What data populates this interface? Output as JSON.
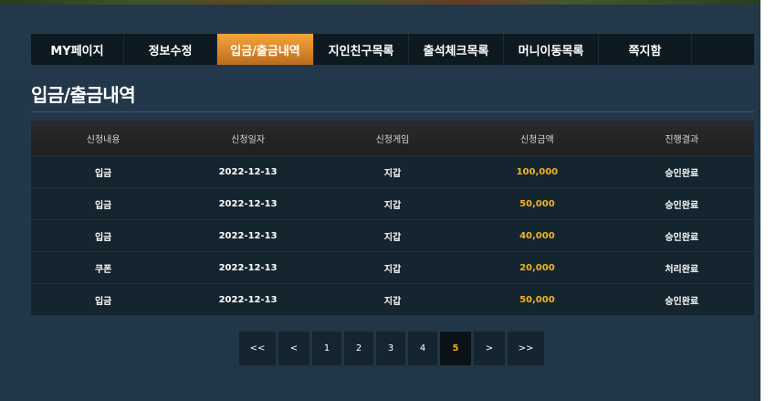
{
  "tabs": [
    {
      "label": "MY페이지"
    },
    {
      "label": "정보수정"
    },
    {
      "label": "입금/출금내역"
    },
    {
      "label": "지인친구목록"
    },
    {
      "label": "출석체크목록"
    },
    {
      "label": "머니이동목록"
    },
    {
      "label": "쪽지함"
    }
  ],
  "active_tab_index": 2,
  "page_title": "입금/출금내역",
  "table": {
    "headers": [
      "신청내용",
      "신청일자",
      "신청게임",
      "신청금액",
      "진행결과"
    ],
    "rows": [
      {
        "type": "입금",
        "date": "2022-12-13",
        "game": "지갑",
        "amount": "100,000",
        "result": "승인완료"
      },
      {
        "type": "입금",
        "date": "2022-12-13",
        "game": "지갑",
        "amount": "50,000",
        "result": "승인완료"
      },
      {
        "type": "입금",
        "date": "2022-12-13",
        "game": "지갑",
        "amount": "40,000",
        "result": "승인완료"
      },
      {
        "type": "쿠폰",
        "date": "2022-12-13",
        "game": "지갑",
        "amount": "20,000",
        "result": "처리완료"
      },
      {
        "type": "입금",
        "date": "2022-12-13",
        "game": "지갑",
        "amount": "50,000",
        "result": "승인완료"
      }
    ]
  },
  "pagination": {
    "first": "<<",
    "prev": "<",
    "pages": [
      "1",
      "2",
      "3",
      "4",
      "5"
    ],
    "current": "5",
    "next": ">",
    "last": ">>"
  },
  "colors": {
    "accent": "#e8952f",
    "amount": "#f1b220",
    "panel": "#21384a"
  }
}
